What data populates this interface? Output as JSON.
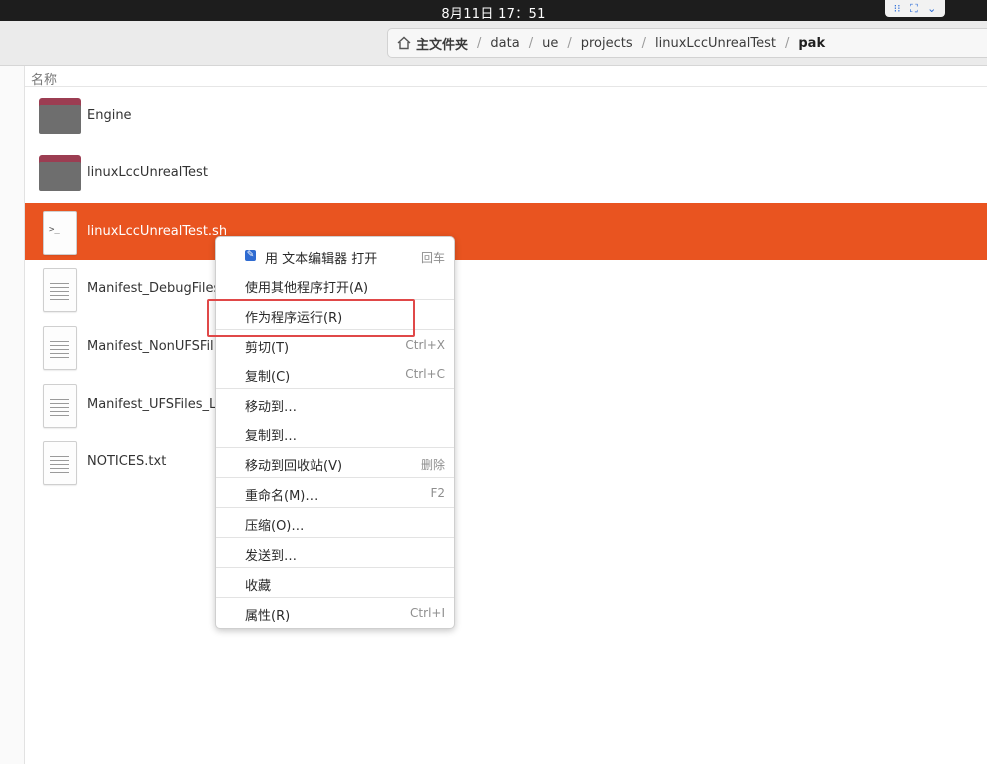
{
  "topbar": {
    "clock": "8月11日  17：51",
    "tray_icons": [
      "grid-icon",
      "expand-icon",
      "chevron-down-icon"
    ]
  },
  "breadcrumb": [
    "主文件夹",
    "data",
    "ue",
    "projects",
    "linuxLccUnrealTest",
    "pak"
  ],
  "list": {
    "column_header": "名称",
    "files": [
      {
        "name": "Engine",
        "type": "folder",
        "selected": false
      },
      {
        "name": "linuxLccUnrealTest",
        "type": "folder",
        "selected": false
      },
      {
        "name": "linuxLccUnrealTest.sh",
        "type": "script",
        "selected": true
      },
      {
        "name": "Manifest_DebugFiles",
        "type": "text",
        "selected": false
      },
      {
        "name": "Manifest_NonUFSFil",
        "type": "text",
        "selected": false
      },
      {
        "name": "Manifest_UFSFiles_L",
        "type": "text",
        "selected": false
      },
      {
        "name": "NOTICES.txt",
        "type": "text",
        "selected": false
      }
    ]
  },
  "context_menu": {
    "items": [
      {
        "label": "用 文本编辑器 打开",
        "accel": "回车",
        "checked": true
      },
      {
        "label": "使用其他程序打开(A)",
        "accel": ""
      },
      {
        "label": "作为程序运行(R)",
        "accel": ""
      },
      {
        "label": "剪切(T)",
        "accel": "Ctrl+X"
      },
      {
        "label": "复制(C)",
        "accel": "Ctrl+C"
      },
      {
        "label": "移动到…",
        "accel": ""
      },
      {
        "label": "复制到…",
        "accel": ""
      },
      {
        "label": "移动到回收站(V)",
        "accel": "删除"
      },
      {
        "label": "重命名(M)…",
        "accel": "F2"
      },
      {
        "label": "压缩(O)…",
        "accel": ""
      },
      {
        "label": "发送到…",
        "accel": ""
      },
      {
        "label": "收藏",
        "accel": ""
      },
      {
        "label": "属性(R)",
        "accel": "Ctrl+I"
      }
    ]
  },
  "colors": {
    "selection": "#e95420",
    "highlight_box": "#e04848",
    "folder_tab": "#9c3d52"
  }
}
